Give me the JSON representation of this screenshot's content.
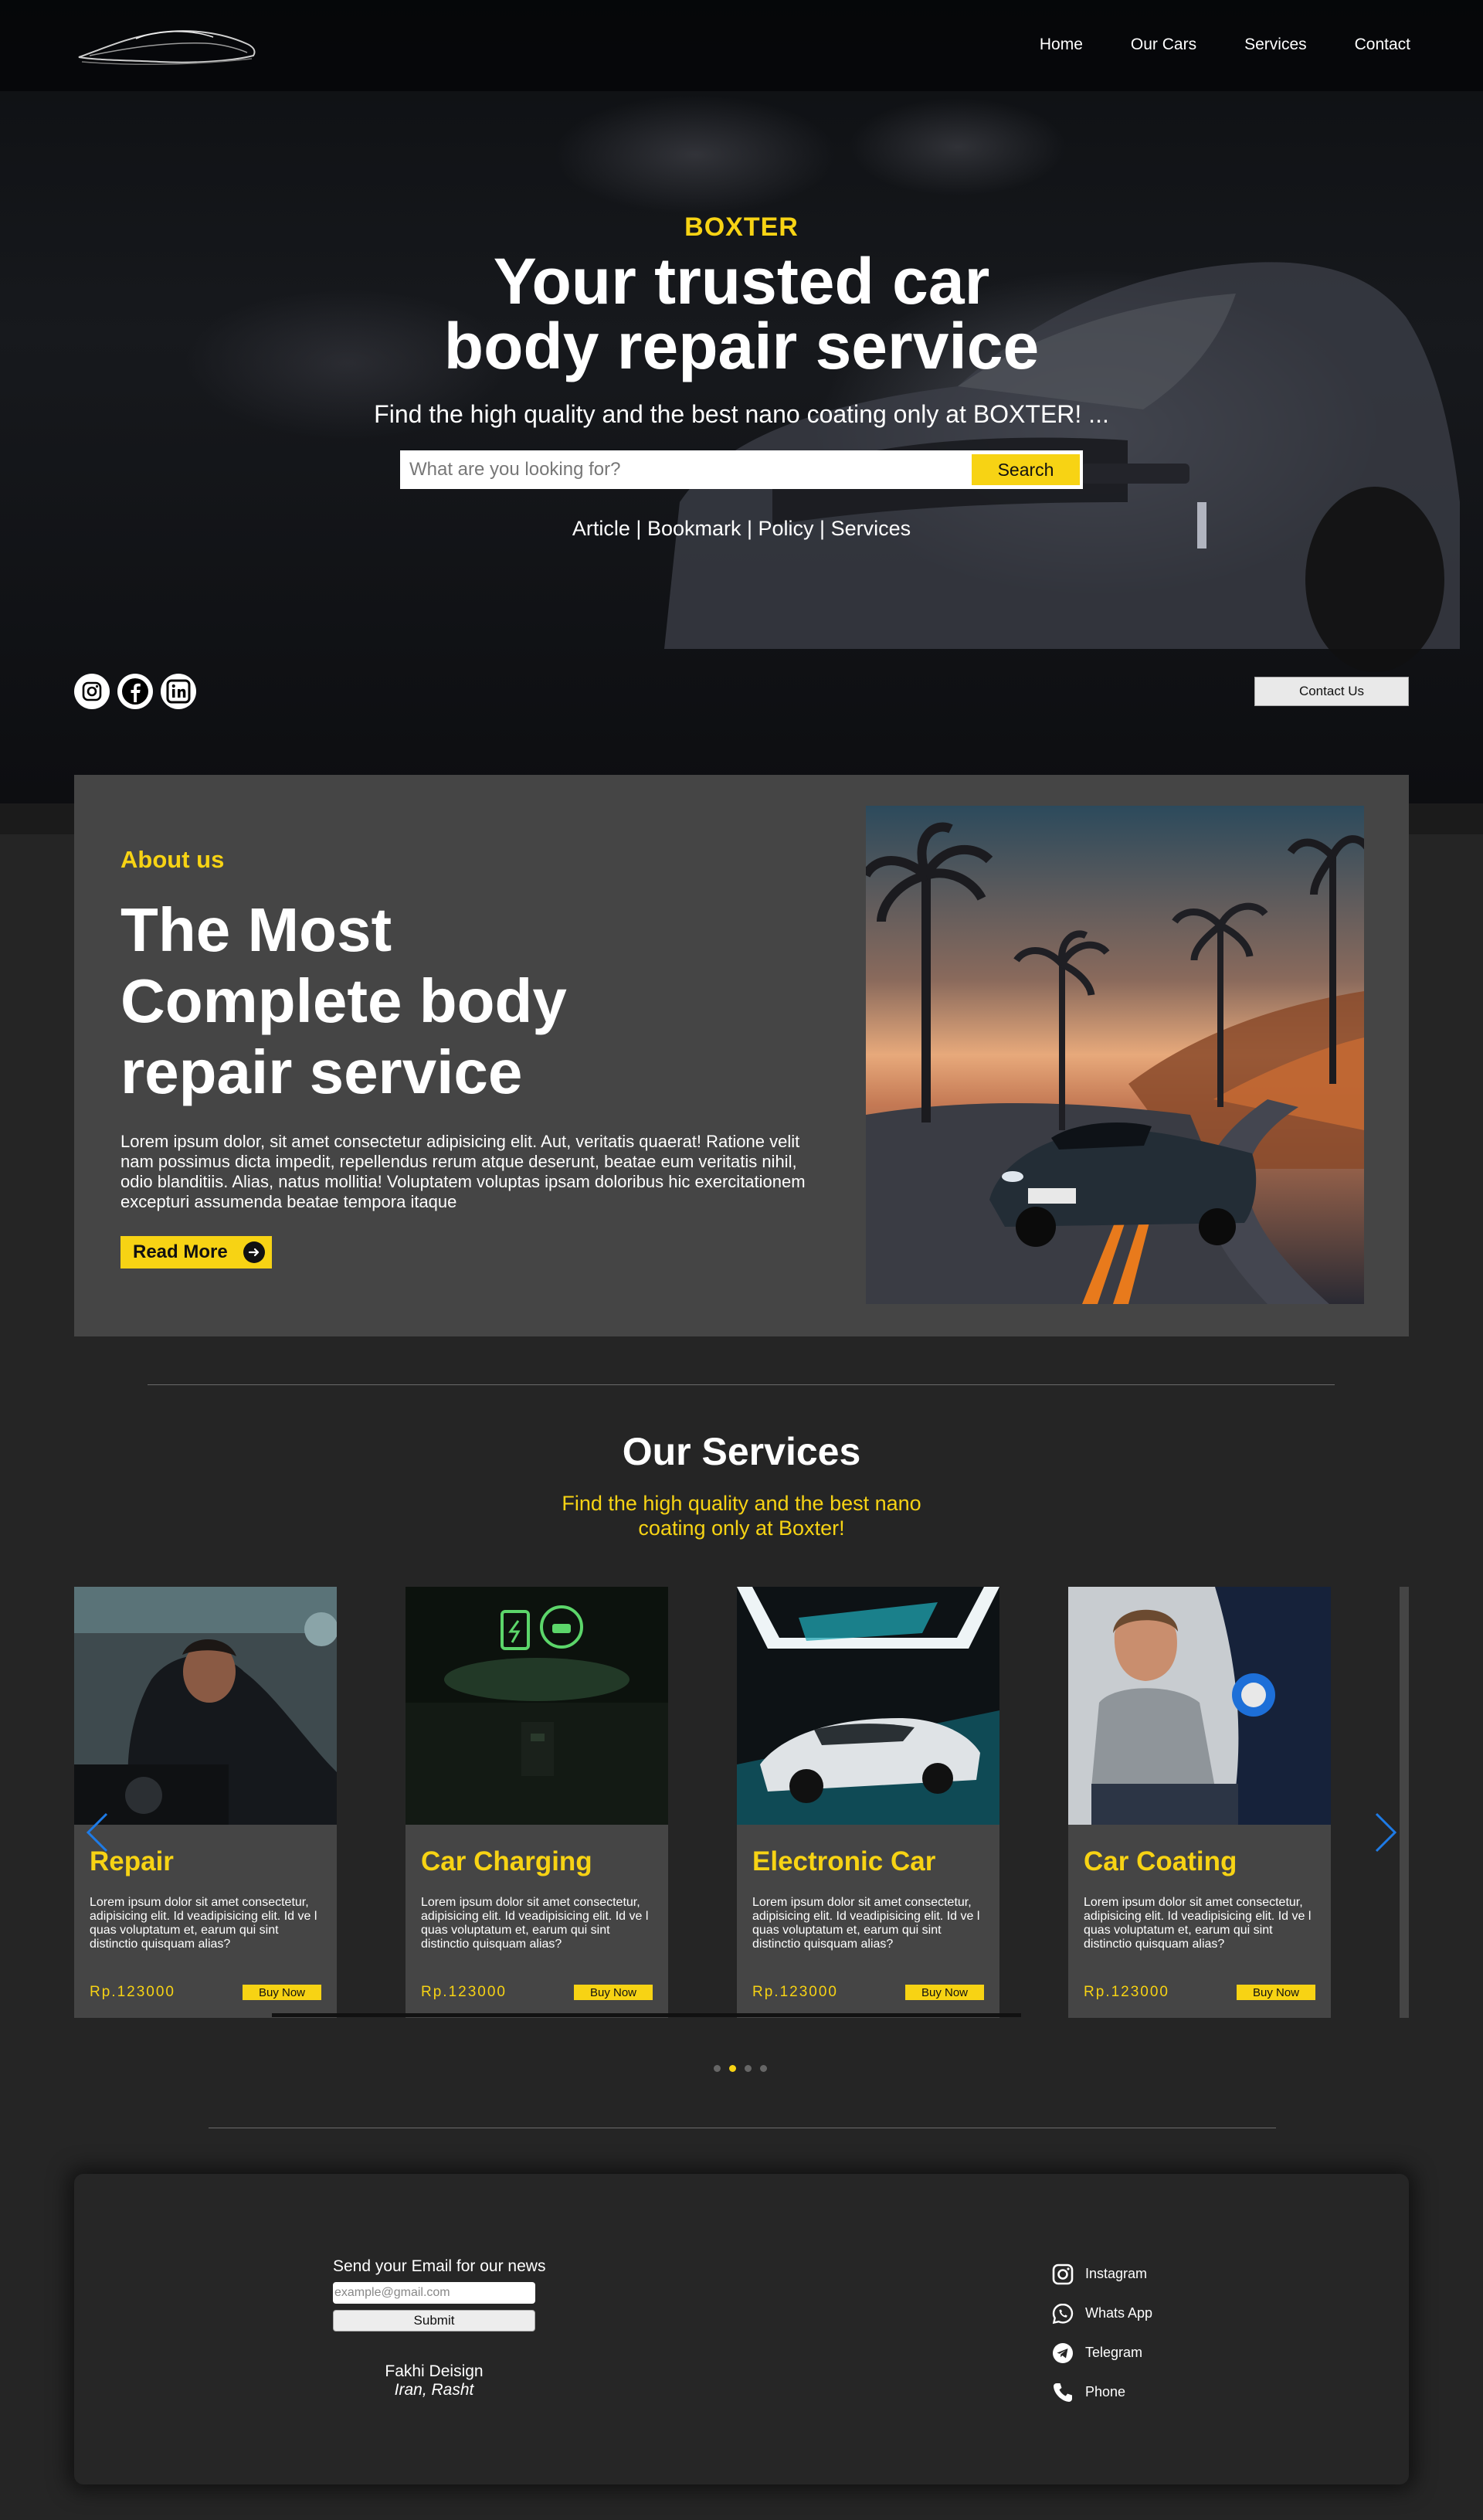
{
  "nav": {
    "links": [
      "Home",
      "Our Cars",
      "Services",
      "Contact"
    ]
  },
  "hero": {
    "kicker": "BOXTER",
    "title_line1": "Your trusted car",
    "title_line2": "body repair service",
    "subtitle": "Find the high quality and the best nano coating only at BOXTER! ...",
    "search_placeholder": "What are you looking for?",
    "search_button": "Search",
    "links": [
      "Article",
      "Bookmark",
      "Policy",
      "Services"
    ],
    "separator": " | ",
    "contact_button": "Contact Us",
    "social_icons": [
      "instagram-icon",
      "facebook-icon",
      "linkedin-icon"
    ]
  },
  "about": {
    "kicker": "About us",
    "title": "The Most Complete body repair service",
    "text": "Lorem ipsum dolor, sit amet consectetur adipisicing elit. Aut, veritatis quaerat! Ratione velit nam possimus dicta impedit, repellendus rerum atque deserunt, beatae eum veritatis nihil, odio blanditiis. Alias, natus mollitia! Voluptatem voluptas ipsam doloribus hic exercitationem excepturi assumenda beatae tempora itaque",
    "read_more": "Read More"
  },
  "services": {
    "title": "Our Services",
    "subtitle": "Find the high quality and the best nano coating only at Boxter!",
    "cards": [
      {
        "title": "Repair",
        "desc": "Lorem ipsum dolor sit amet consectetur, adipisicing elit. Id veadipisicing elit. Id ve l quas voluptatum et, earum qui sint distinctio quisquam alias?",
        "price": "Rp.123000",
        "buy": "Buy Now"
      },
      {
        "title": "Car Charging",
        "desc": "Lorem ipsum dolor sit amet consectetur, adipisicing elit. Id veadipisicing elit. Id ve l quas voluptatum et, earum qui sint distinctio quisquam alias?",
        "price": "Rp.123000",
        "buy": "Buy Now"
      },
      {
        "title": "Electronic Car",
        "desc": "Lorem ipsum dolor sit amet consectetur, adipisicing elit. Id veadipisicing elit. Id ve l quas voluptatum et, earum qui sint distinctio quisquam alias?",
        "price": "Rp.123000",
        "buy": "Buy Now"
      },
      {
        "title": "Car Coating",
        "desc": "Lorem ipsum dolor sit amet consectetur, adipisicing elit. Id veadipisicing elit. Id ve l quas voluptatum et, earum qui sint distinctio quisquam alias?",
        "price": "Rp.123000",
        "buy": "Buy Now"
      }
    ],
    "active_page": 2,
    "page_count": 4
  },
  "footer": {
    "news_label": "Send your Email for our news",
    "email_placeholder": "example@gmail.com",
    "submit": "Submit",
    "company": "Fakhi Deisign",
    "location": "Iran, Rasht",
    "contacts": [
      {
        "label": "Instagram",
        "icon": "instagram-icon"
      },
      {
        "label": "Whats App",
        "icon": "whatsapp-icon"
      },
      {
        "label": "Telegram",
        "icon": "telegram-icon"
      },
      {
        "label": "Phone",
        "icon": "phone-icon"
      }
    ]
  },
  "colors": {
    "accent": "#f7d314",
    "background": "#252525",
    "panel": "#454545",
    "arrow": "#1e7be6"
  }
}
